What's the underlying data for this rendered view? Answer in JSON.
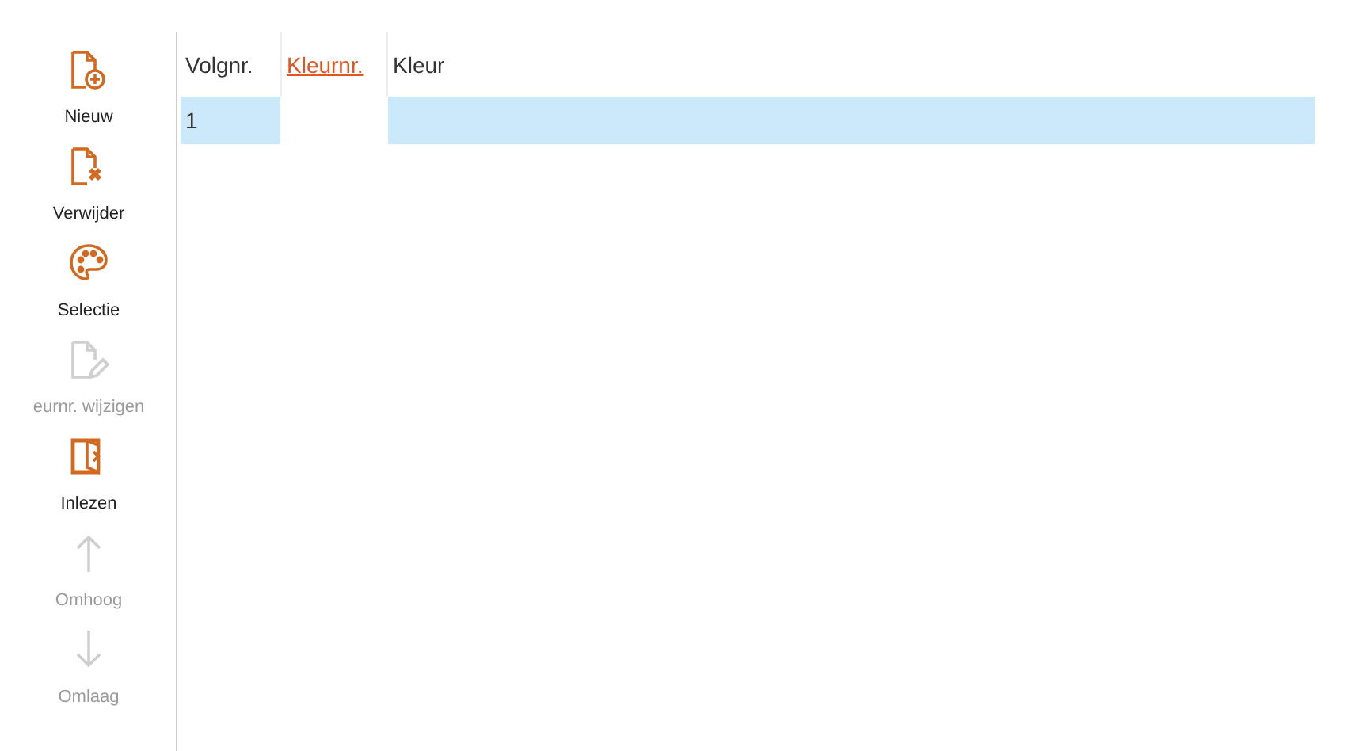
{
  "toolbar": [
    {
      "kind": "new",
      "label": "Nieuw",
      "disabled": false
    },
    {
      "kind": "delete",
      "label": "Verwijder",
      "disabled": false
    },
    {
      "kind": "palette",
      "label": "Selectie",
      "disabled": false
    },
    {
      "kind": "edit",
      "label": "eurnr. wijzigen",
      "disabled": true
    },
    {
      "kind": "import",
      "label": "Inlezen",
      "disabled": false
    },
    {
      "kind": "up",
      "label": "Omhoog",
      "disabled": true
    },
    {
      "kind": "down",
      "label": "Omlaag",
      "disabled": true
    }
  ],
  "table": {
    "columns": [
      {
        "label": "Volgnr.",
        "selected": false
      },
      {
        "label": "Kleurnr.",
        "selected": true
      },
      {
        "label": "Kleur",
        "selected": false
      }
    ],
    "rows": [
      {
        "selected": true,
        "cells": [
          "1"
        ]
      }
    ]
  }
}
